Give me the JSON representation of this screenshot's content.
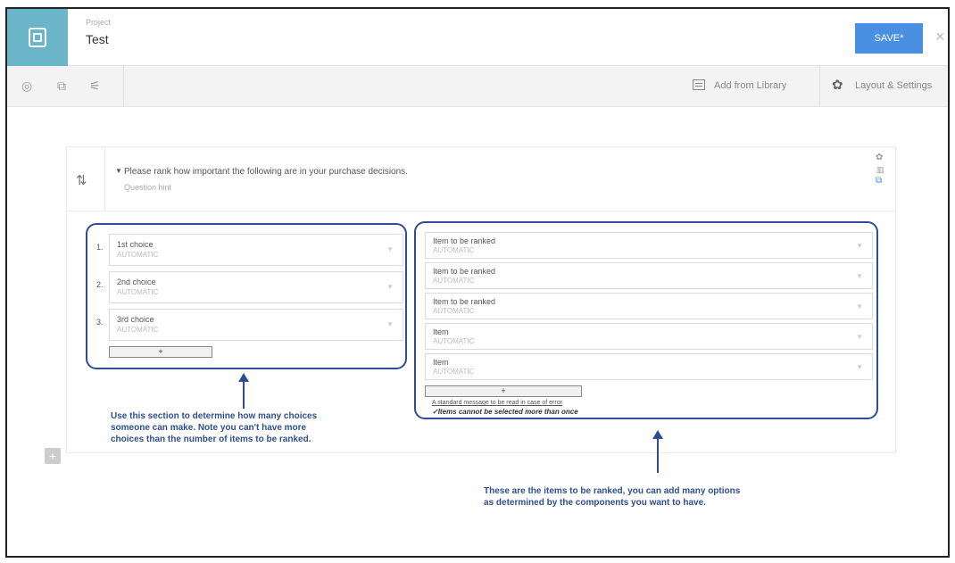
{
  "header": {
    "project_caption": "Project",
    "project_name": "Test",
    "save_label": "SAVE*",
    "close_symbol": "×"
  },
  "toolbar": {
    "icons": [
      "eye-icon",
      "copy-icon",
      "logic-icon"
    ],
    "add_library_label": "Add from Library",
    "layout_settings_label": "Layout & Settings"
  },
  "question": {
    "text": "Please rank how important the following are in your purchase decisions.",
    "hint": "Question hint"
  },
  "choices": [
    {
      "num": "1.",
      "label": "1st choice",
      "sub": "AUTOMATIC"
    },
    {
      "num": "2.",
      "label": "2nd choice",
      "sub": "AUTOMATIC"
    },
    {
      "num": "3.",
      "label": "3rd choice",
      "sub": "AUTOMATIC"
    }
  ],
  "items": [
    {
      "label": "Item to be ranked",
      "sub": "AUTOMATIC"
    },
    {
      "label": "Item to be ranked",
      "sub": "AUTOMATIC"
    },
    {
      "label": "Item to be ranked",
      "sub": "AUTOMATIC"
    },
    {
      "label": "Item",
      "sub": "AUTOMATIC"
    },
    {
      "label": "Item",
      "sub": "AUTOMATIC"
    }
  ],
  "plus_label": "+",
  "notes": {
    "link": "A standard message to be read in case of error",
    "check": "✓Items cannot be selected more than once"
  },
  "annotations": {
    "left": [
      "Use this section to determine how many choices",
      "someone can make. Note you can't have more",
      "choices than the number of items to be ranked."
    ],
    "right": [
      "These are the items to be ranked, you can add many options",
      "as determined by the components you want to have."
    ]
  },
  "colors": {
    "accent": "#4a90e2",
    "logo_bg": "#6ab5c8",
    "annotation": "#2e4f8f"
  }
}
